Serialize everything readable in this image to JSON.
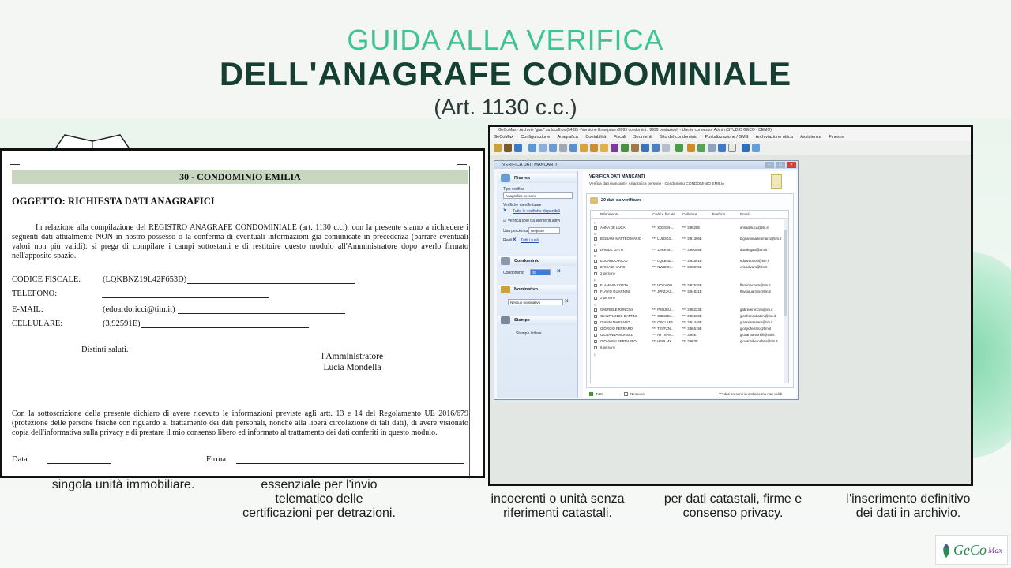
{
  "header": {
    "line1": "GUIDA ALLA VERIFICA",
    "line2": "DELL'ANAGRAFE CONDOMINIALE",
    "line3": "(Art. 1130 c.c.)"
  },
  "captions": {
    "c1": "singola unità immobiliare.",
    "c2": "essenziale per l'invio\ntelematico delle\ncertificazioni per detrazioni.",
    "c3": "incoerenti o unità senza\nriferimenti catastali.",
    "c4": "per dati catastali, firme e\nconsenso privacy.",
    "c5": "l'inserimento definitivo\ndei dati in archivio."
  },
  "document": {
    "band": "30 - CONDOMINIO EMILIA",
    "subject": "OGGETTO: RICHIESTA DATI ANAGRAFICI",
    "paragraph": "In relazione alla compilazione del REGISTRO ANAGRAFE CONDOMINIALE (art. 1130 c.c.), con la presente siamo a richiedere i seguenti dati attualmente NON in nostro possesso o la conferma di eventuali informazioni già comunicate in precedenza (barrare eventuali valori non più validi): si prega di compilare i campi sottostanti e di restituire questo modulo all'Amministratore dopo averlo firmato nell'apposito spazio.",
    "fields": [
      {
        "label": "CODICE FISCALE:",
        "value": "(LQKBNZ19L42F653D)"
      },
      {
        "label": "TELEFONO:",
        "value": ""
      },
      {
        "label": "E-MAIL:",
        "value": "(edoardoricci@tim.it)"
      },
      {
        "label": "CELLULARE:",
        "value": "(3,92591E)"
      }
    ],
    "greeting": "Distinti saluti.",
    "admin_title": "l'Amministratore",
    "admin_name": "Lucia Mondella",
    "footer": "Con la sottoscrizione della presente dichiaro di avere ricevuto le informazioni previste agli artt. 13 e 14 del Regolamento UE 2016/679 (protezione delle persone fisiche con riguardo al trattamento dei dati personali, nonché alla libera circolazione di tali dati), di avere visionato copia dell'informativa sulla privacy e di prestare il mio consenso libero ed informato al trattamento dei dati conferiti in questo modulo.",
    "date_label": "Data",
    "sign_label": "Firma"
  },
  "app": {
    "title": "GeCoMax - Archivio \"giac\" su localhost(5432) - Versione Enterprise (9999 condomini / 9999 postazioni) - Utente connesso: Admin (STUDIO GECO - DEMO)",
    "menu": [
      "GeCoMax",
      "Configurazione",
      "Anagrafica",
      "Contabilità",
      "Fiscali",
      "Strumenti",
      "Sito del condominio",
      "Postalizzazione / SMS",
      "Archiviazione ottica",
      "Assistenza",
      "Finestre"
    ],
    "dialog_title": "VERIFICA DATI MANCANTI",
    "side": {
      "ricerca": "Ricerca",
      "tipo_verifica_label": "Tipo verifica",
      "tipo_verifica_value": "Anagrafica persone",
      "verifiche_label": "Verifiche da effettuare",
      "tutte_link": "Tutte le verifiche disponibili",
      "solo_attivi": "Verifica solo tra elementi attivi",
      "percentuali_label": "Usa percentuali",
      "percentuali_value": "Registro",
      "ruoli_label": "Ruoli",
      "ruoli_link": "Tutti i ruoli",
      "condominio": "Condominio",
      "condominio_label": "Condominio",
      "condominio_value": "30",
      "nominativo": "Nominativo",
      "nominativo_value": "Nessun nominativo",
      "stampe": "Stampe",
      "stampa_lettera": "Stampa lettera"
    },
    "main": {
      "heading": "VERIFICA DATI MANCANTI",
      "subheading": "Verifica dati mancanti - Anagrafica persone - Condominio CONDOMINIO EMILIA",
      "group_title": "20 dati da verificare",
      "columns": [
        "Riferimento",
        "Codice fiscale",
        "Cellulare",
        "Telefono",
        "Email"
      ],
      "rows": [
        {
          "type": "letter",
          "name": "A"
        },
        {
          "type": "row",
          "name": "ANNA DE LUCA",
          "cf": "*** XDSSBH...",
          "cell": "*** 3,9528E",
          "tel": "",
          "email": "annadeluca@tim.it"
        },
        {
          "type": "letter",
          "name": "B"
        },
        {
          "type": "row",
          "name": "BIGNAMI MATTEO MARIO",
          "cf": "*** LULDG3...",
          "cell": "*** 3,91306E",
          "tel": "",
          "email": "bignamimatteomario@tim.it"
        },
        {
          "type": "letter",
          "name": "D"
        },
        {
          "type": "row",
          "name": "DAVIDE GATTI",
          "cf": "*** JJIRK28...",
          "cell": "*** 3,99005E",
          "tel": "",
          "email": "davidegatti@tim.it"
        },
        {
          "type": "letter",
          "name": "E"
        },
        {
          "type": "row",
          "name": "EDOARDO RICCI",
          "cf": "*** LQKBNZ...",
          "cell": "*** 3,92591E",
          "tel": "",
          "email": "edoardoricci@tim.it"
        },
        {
          "type": "row",
          "name": "ERICA DI VARO",
          "cf": "*** NWBMX...",
          "cell": "*** 3,98375E",
          "tel": "",
          "email": "ericadivaro@tim.it"
        },
        {
          "type": "count",
          "name": "2 persone"
        },
        {
          "type": "letter",
          "name": "F"
        },
        {
          "type": "row",
          "name": "FLAMINIA COSTA",
          "cf": "*** HOKVYM...",
          "cell": "*** 3,97526E",
          "tel": "",
          "email": "flaminiacosta@tim.it"
        },
        {
          "type": "row",
          "name": "FLAVIO GUARNINI",
          "cf": "*** JPFZJA2...",
          "cell": "*** 3,94831E",
          "tel": "",
          "email": "flavioguarnini@tim.it"
        },
        {
          "type": "count",
          "name": "2 persone"
        },
        {
          "type": "letter",
          "name": "G"
        },
        {
          "type": "row",
          "name": "GABRIELE RONCINI",
          "cf": "*** PSUJEU...",
          "cell": "*** 3,98223E",
          "tel": "",
          "email": "gabrieleroncini@tim.it"
        },
        {
          "type": "row",
          "name": "GIANFRANCO BATTINI",
          "cf": "*** CBEIZB4...",
          "cell": "*** 3,98203E",
          "tel": "",
          "email": "gianfrancobattini@tim.it"
        },
        {
          "type": "row",
          "name": "GIANNI MASSARO",
          "cf": "*** OSCLAF6...",
          "cell": "*** 3,91448E",
          "tel": "",
          "email": "giannimassaro@tim.it"
        },
        {
          "type": "row",
          "name": "GIORGIO FERRARO",
          "cf": "*** TSVFZN...",
          "cell": "*** 3,96519E",
          "tel": "",
          "email": "giorgioferraro@tim.it"
        },
        {
          "type": "row",
          "name": "GIOVANNA MORELLI",
          "cf": "*** RTTXPM...",
          "cell": "*** 3,95E",
          "tel": "",
          "email": "giovannamorelli@tim.it"
        },
        {
          "type": "row",
          "name": "GIOVANNI BERNABEO",
          "cf": "*** HFOLMX...",
          "cell": "*** 3,983E",
          "tel": "",
          "email": "giovannibernabeo@tim.it"
        },
        {
          "type": "count",
          "name": "6 persone"
        },
        {
          "type": "letter",
          "name": "L"
        }
      ],
      "footer_all": "Tutti",
      "footer_none": "Nessuno",
      "footer_note": "*** dati presenti in archivio ma non validi"
    }
  },
  "logo": {
    "text": "GeCo",
    "suffix": "Max"
  },
  "colors": {
    "accent": "#3cc495",
    "dark": "#163f33",
    "band": "#c8d6c0"
  }
}
